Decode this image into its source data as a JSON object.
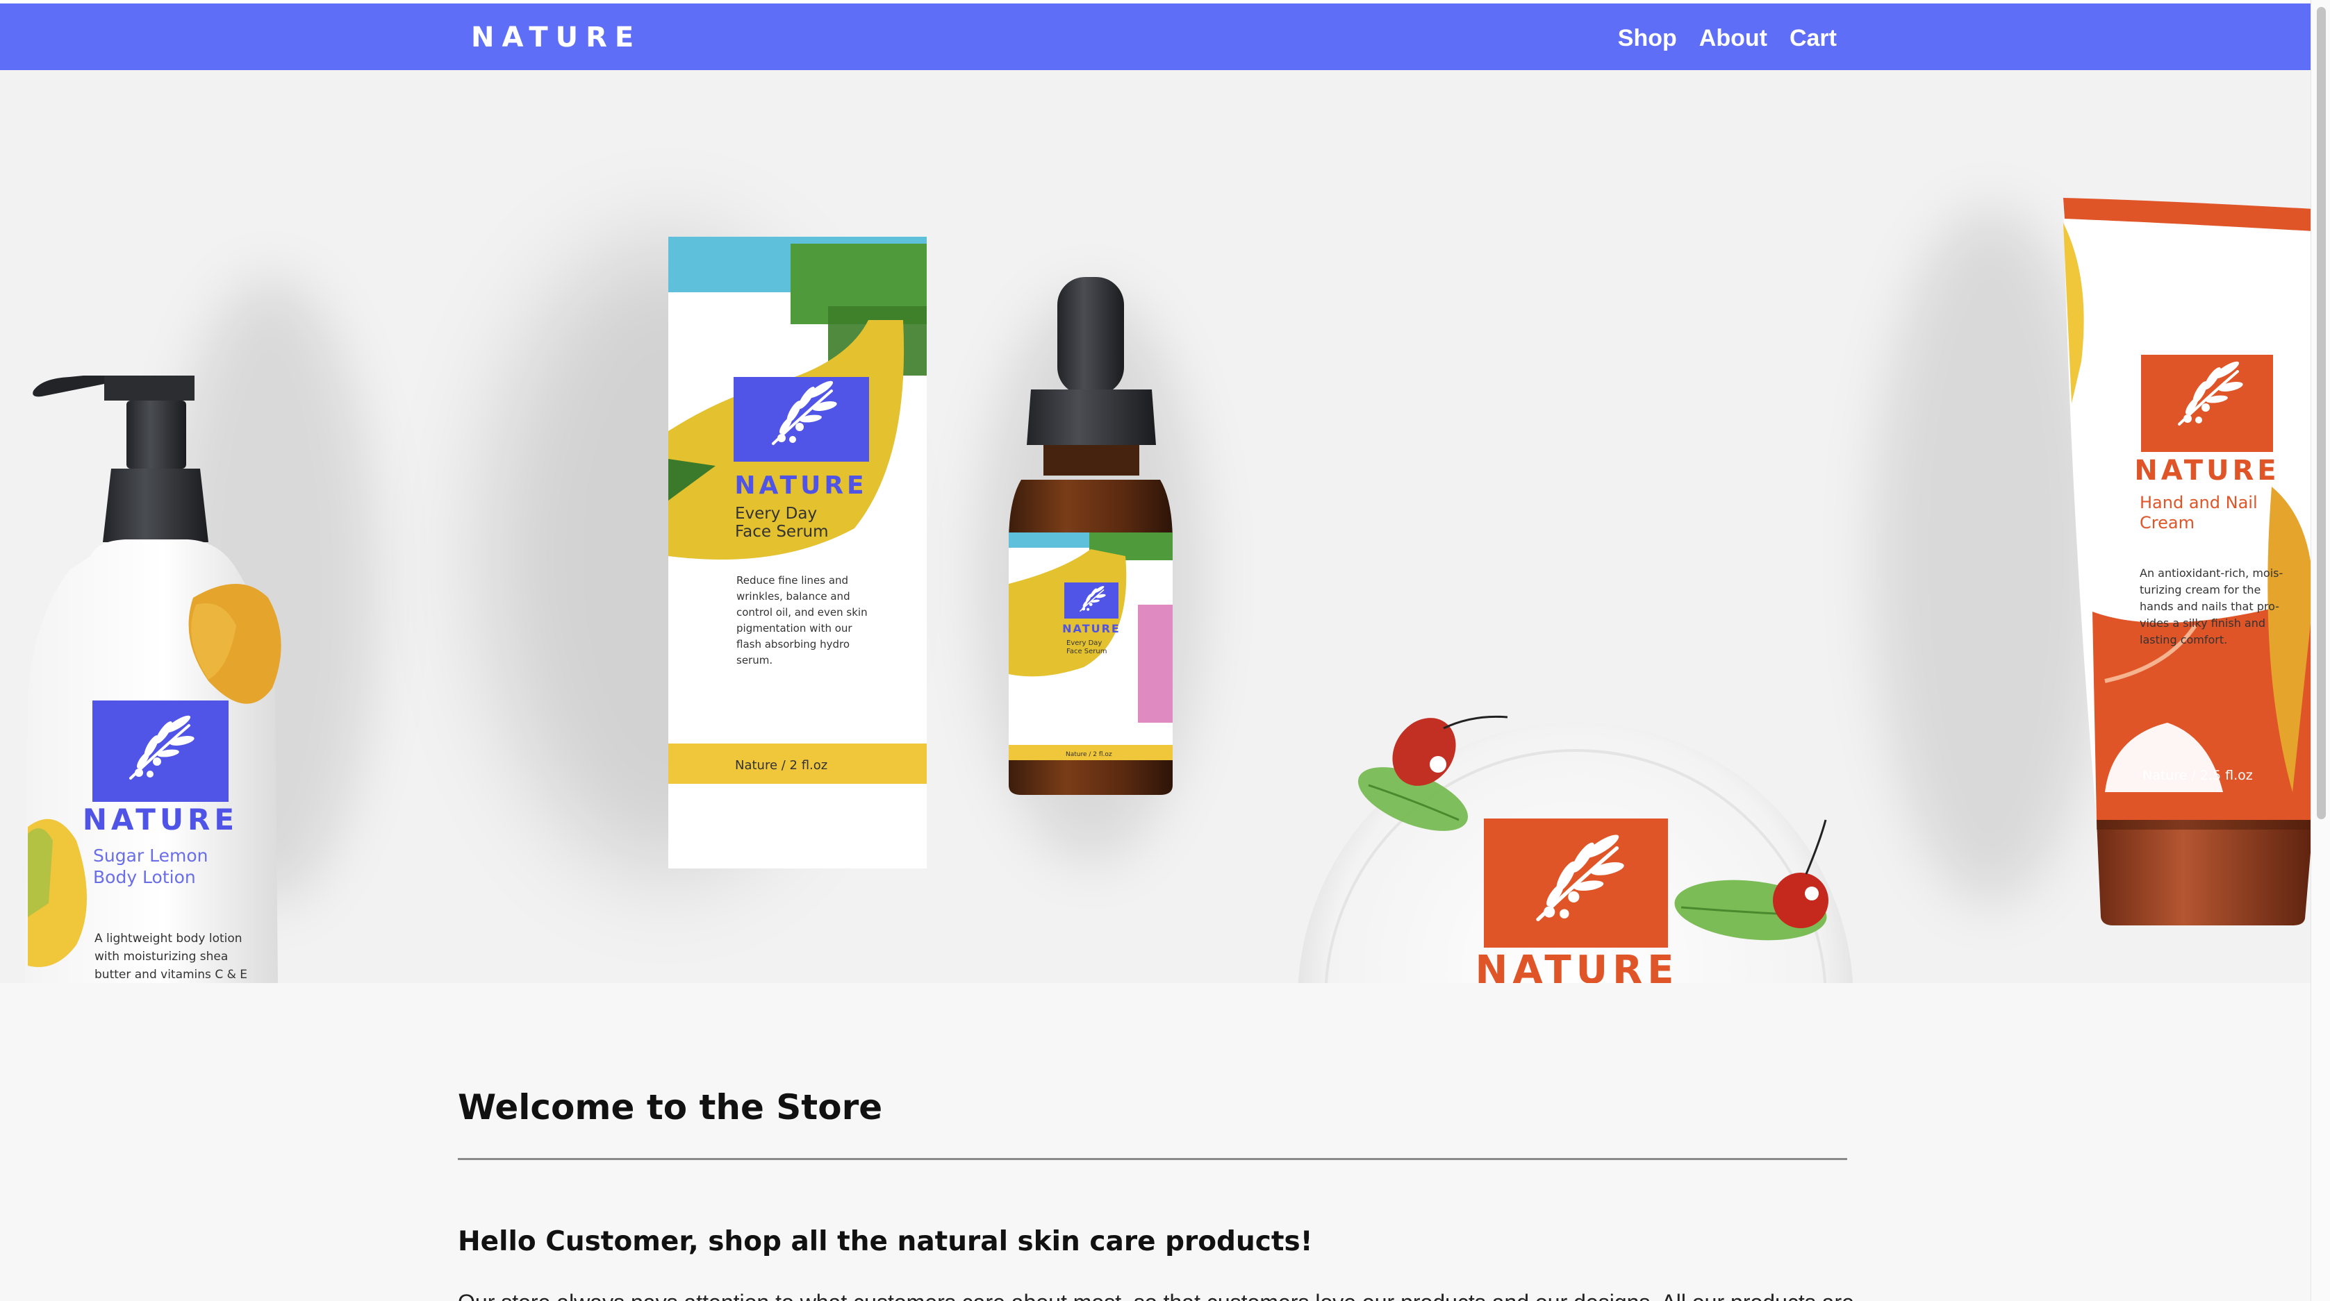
{
  "nav": {
    "brand": "NATURE",
    "links": [
      "Shop",
      "About",
      "Cart"
    ]
  },
  "hero": {
    "lotion": {
      "brand": "NATURE",
      "name_line1": "Sugar Lemon",
      "name_line2": "Body Lotion",
      "desc_line1": "A lightweight body lotion",
      "desc_line2": "with moisturizing shea",
      "desc_line3": "butter and vitamins C & E"
    },
    "serum_box": {
      "brand": "NATURE",
      "name_line1": "Every Day",
      "name_line2": "Face Serum",
      "desc_line1": "Reduce fine lines and",
      "desc_line2": "wrinkles, balance and",
      "desc_line3": "control oil, and even skin",
      "desc_line4": "pigmentation  with our",
      "desc_line5": "flash absorbing hydro",
      "desc_line6": "serum.",
      "footer": "Nature /  2 fl.oz"
    },
    "serum_bottle": {
      "brand": "NATURE",
      "name_line1": "Every Day",
      "name_line2": "Face Serum",
      "footer": "Nature /  2 fl.oz"
    },
    "jar": {
      "brand": "NATURE"
    },
    "cream_tube": {
      "brand": "NATURE",
      "name_line1": "Hand and Nail",
      "name_line2": "Cream",
      "desc_line1": "An antioxidant-rich, mois-",
      "desc_line2": "turizing cream for the",
      "desc_line3": "hands and nails that pro-",
      "desc_line4": "vides a silky finish and",
      "desc_line5": "lasting comfort.",
      "footer": "Nature /  2.5 fl.oz"
    }
  },
  "content": {
    "welcome_title": "Welcome to the Store",
    "hello_heading": "Hello Customer, shop all the natural skin care products!",
    "paragraph": "Our store always pays attention to what customers care about most, so that customers love our products and our designs. All our products are"
  },
  "colors": {
    "nav_bg": "#5f6ef7",
    "brand_blue": "#5055e8",
    "brand_orange": "#e05528",
    "accent_yellow": "#f0c63a",
    "accent_green": "#4f9a3a",
    "accent_cyan": "#5fc0dc"
  },
  "icons": [
    "olive-branch-logo-icon",
    "ladybug-icon",
    "leaf-icon",
    "lemon-icon"
  ]
}
